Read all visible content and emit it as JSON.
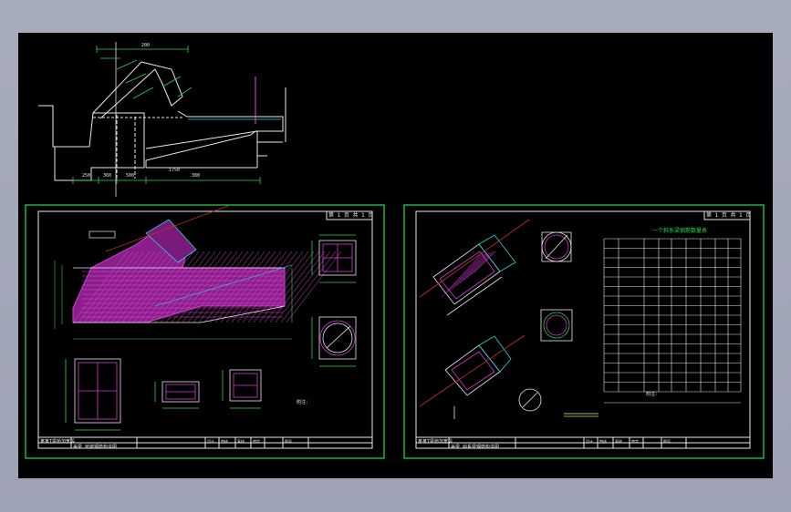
{
  "colors": {
    "background": "#000000",
    "frame": "#a3a8b9",
    "border_green": "#29d84a",
    "rebar_magenta": "#d23cd0",
    "line_white": "#e8e8e8",
    "dim_green": "#2fd24f",
    "text_yellow": "#e7e72a",
    "axis_red": "#c83030",
    "cyan": "#2ad4d8"
  },
  "left_sheet": {
    "corner_tag": "第 1 页 共 1 页",
    "title_cells": [
      "设计",
      "审核",
      "复核",
      "审定",
      "图号",
      "日期",
      "比例"
    ],
    "block_texts": [
      "某某T梁桥加宽段",
      "盖梁 桥墩钢筋构造图",
      "附注："
    ]
  },
  "right_sheet": {
    "corner_tag": "第 1 页 共 1 页",
    "table_title": "一个斜系梁钢筋数量表",
    "table_headers": [
      "编号",
      "钢筋形式",
      "直径",
      "根数",
      "单长",
      "共长",
      "总重"
    ],
    "table_rows": 14,
    "notes_title": "附注：",
    "block_texts": [
      "某某T梁桥加宽段",
      "盖梁 斜系梁钢筋构造图"
    ]
  },
  "top_drawing": {
    "dims": [
      "1750",
      "250",
      "360",
      "500",
      "380",
      "200"
    ]
  }
}
